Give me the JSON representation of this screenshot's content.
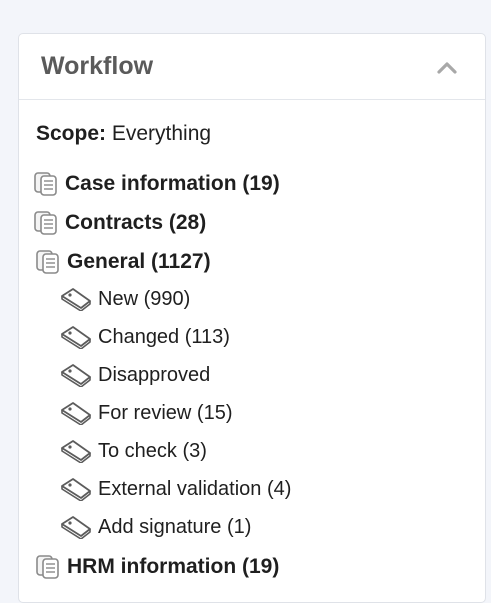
{
  "panel": {
    "title": "Workflow",
    "collapse_icon": "chevron-up-icon"
  },
  "scope": {
    "label": "Scope:",
    "value": "Everything"
  },
  "categories": [
    {
      "label": "Case information (19)",
      "icon": "documents-icon"
    },
    {
      "label": "Contracts (28)",
      "icon": "documents-icon"
    },
    {
      "label": "General (1127)",
      "icon": "documents-icon"
    },
    {
      "label": "HRM information (19)",
      "icon": "documents-icon"
    }
  ],
  "general_items": [
    {
      "label": "New (990)",
      "icon": "tag-icon"
    },
    {
      "label": "Changed (113)",
      "icon": "tag-icon"
    },
    {
      "label": "Disapproved",
      "icon": "tag-icon"
    },
    {
      "label": "For review (15)",
      "icon": "tag-icon"
    },
    {
      "label": "To check (3)",
      "icon": "tag-icon"
    },
    {
      "label": "External validation (4)",
      "icon": "tag-icon"
    },
    {
      "label": "Add signature (1)",
      "icon": "tag-icon"
    }
  ]
}
